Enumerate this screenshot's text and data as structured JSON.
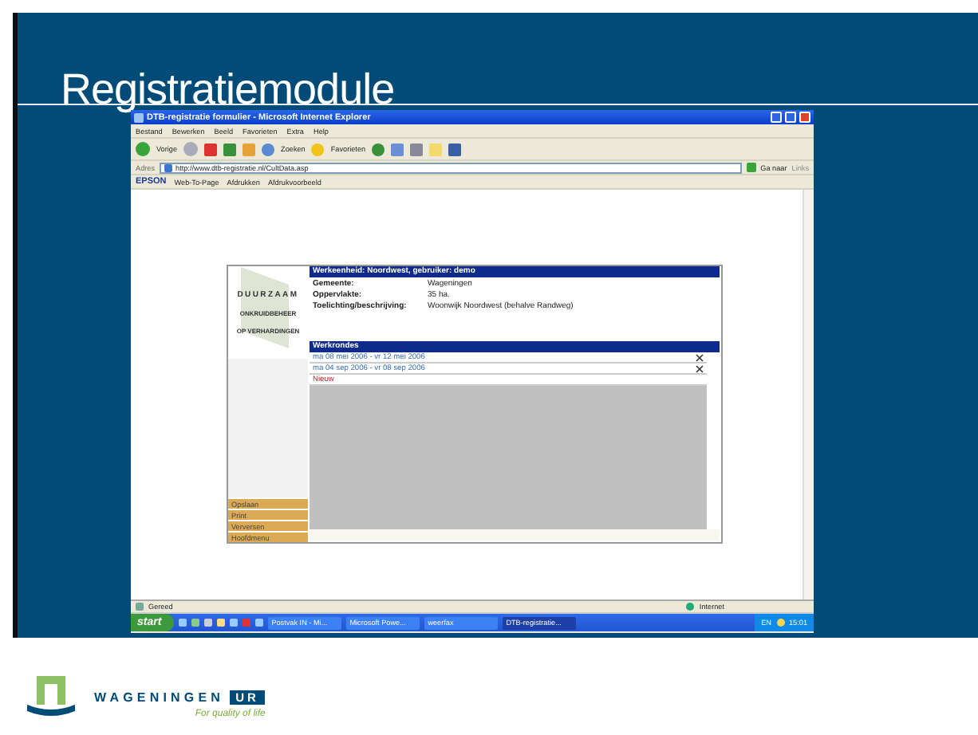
{
  "slide": {
    "title": "Registratiemodule"
  },
  "browser": {
    "title": "DTB-registratie formulier - Microsoft Internet Explorer",
    "menu": [
      "Bestand",
      "Bewerken",
      "Beeld",
      "Favorieten",
      "Extra",
      "Help"
    ],
    "toolbar": [
      "Vorige",
      "Zoeken",
      "Favorieten"
    ],
    "address_label": "Adres",
    "url": "http://www.dtb-registratie.nl/CultData.asp",
    "go": "Ga naar",
    "links": "Links",
    "epson": {
      "brand": "EPSON",
      "items": [
        "Web-To-Page",
        "Afdrukken",
        "Afdrukvoorbeeld"
      ]
    },
    "form": {
      "logo_lines": [
        "DUURZAAM",
        "ONKRUIDBEHEER",
        "OP VERHARDINGEN"
      ],
      "header": "Werkeenheid: Noordwest, gebruiker: demo",
      "fields": [
        {
          "label": "Gemeente:",
          "value": "Wageningen"
        },
        {
          "label": "Oppervlakte:",
          "value": "35 ha."
        },
        {
          "label": "Toelichting/beschrijving:",
          "value": "Woonwijk Noordwest (behalve Randweg)"
        }
      ],
      "section": "Werkrondes",
      "rounds": [
        "ma 08 mei 2006 - vr 12 mei 2006",
        "ma 04 sep 2006 - vr 08 sep 2006"
      ],
      "new": "Nieuw",
      "side_menu": [
        "Opslaan",
        "Print",
        "Verversen",
        "Hoofdmenu"
      ]
    },
    "status": "Gereed",
    "zone": "Internet",
    "taskbar": {
      "start": "start",
      "tasks": [
        {
          "label": "Postvak IN - Mi...",
          "selected": false
        },
        {
          "label": "Microsoft Powe...",
          "selected": false
        },
        {
          "label": "weerfax",
          "selected": false
        },
        {
          "label": "DTB-registratie...",
          "selected": true
        }
      ],
      "lang": "EN",
      "clock": "15:01"
    }
  },
  "footer": {
    "brand": "WAGENINGEN",
    "brand_box": "UR",
    "tagline": "For quality of life"
  }
}
